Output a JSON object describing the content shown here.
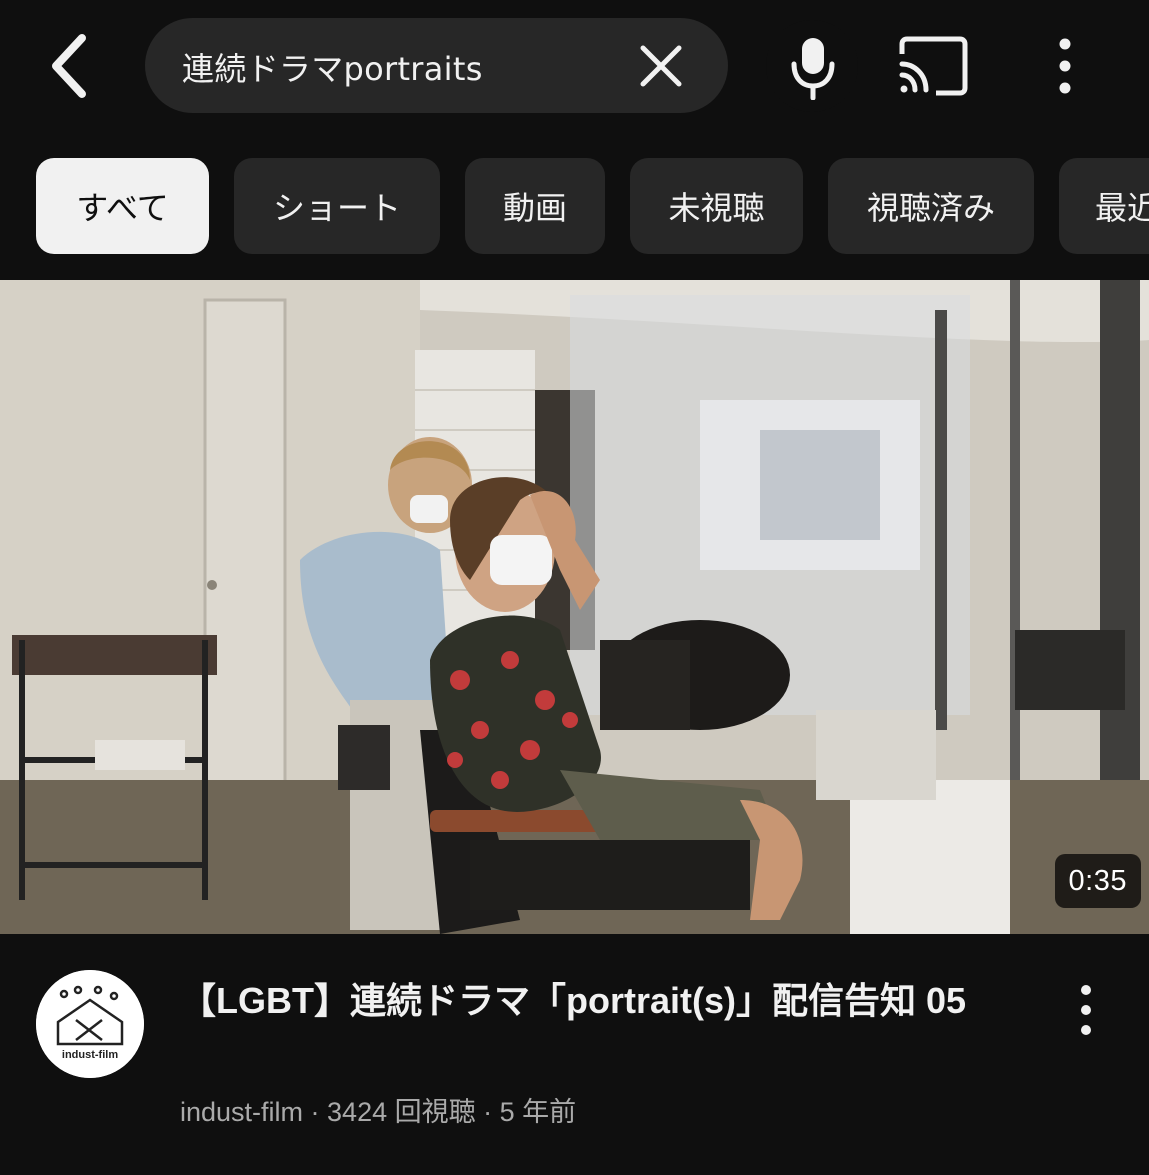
{
  "search": {
    "query": "連続ドラマportraits"
  },
  "filters": {
    "chips": [
      {
        "label": "すべて",
        "selected": true
      },
      {
        "label": "ショート",
        "selected": false
      },
      {
        "label": "動画",
        "selected": false
      },
      {
        "label": "未視聴",
        "selected": false
      },
      {
        "label": "視聴済み",
        "selected": false
      },
      {
        "label": "最近",
        "selected": false
      }
    ]
  },
  "video": {
    "duration": "0:35",
    "title": "【LGBT】連続ドラマ「portrait(s)」配信告知 05",
    "channel": "indust-film",
    "views": "3424 回視聴",
    "age": "5 年前",
    "separator": " · "
  },
  "channel_avatar": {
    "logo_text": "indust-film",
    "logo_mark": "X"
  },
  "icons": {
    "back": "chevron-left-icon",
    "clear": "close-icon",
    "mic": "microphone-icon",
    "cast": "cast-icon",
    "more": "more-vert-icon"
  },
  "colors": {
    "background": "#0f0f0f",
    "chip": "#272727",
    "chip_active": "#f1f1f1",
    "text_primary": "#f1f1f1",
    "text_secondary": "#aaaaaa"
  }
}
